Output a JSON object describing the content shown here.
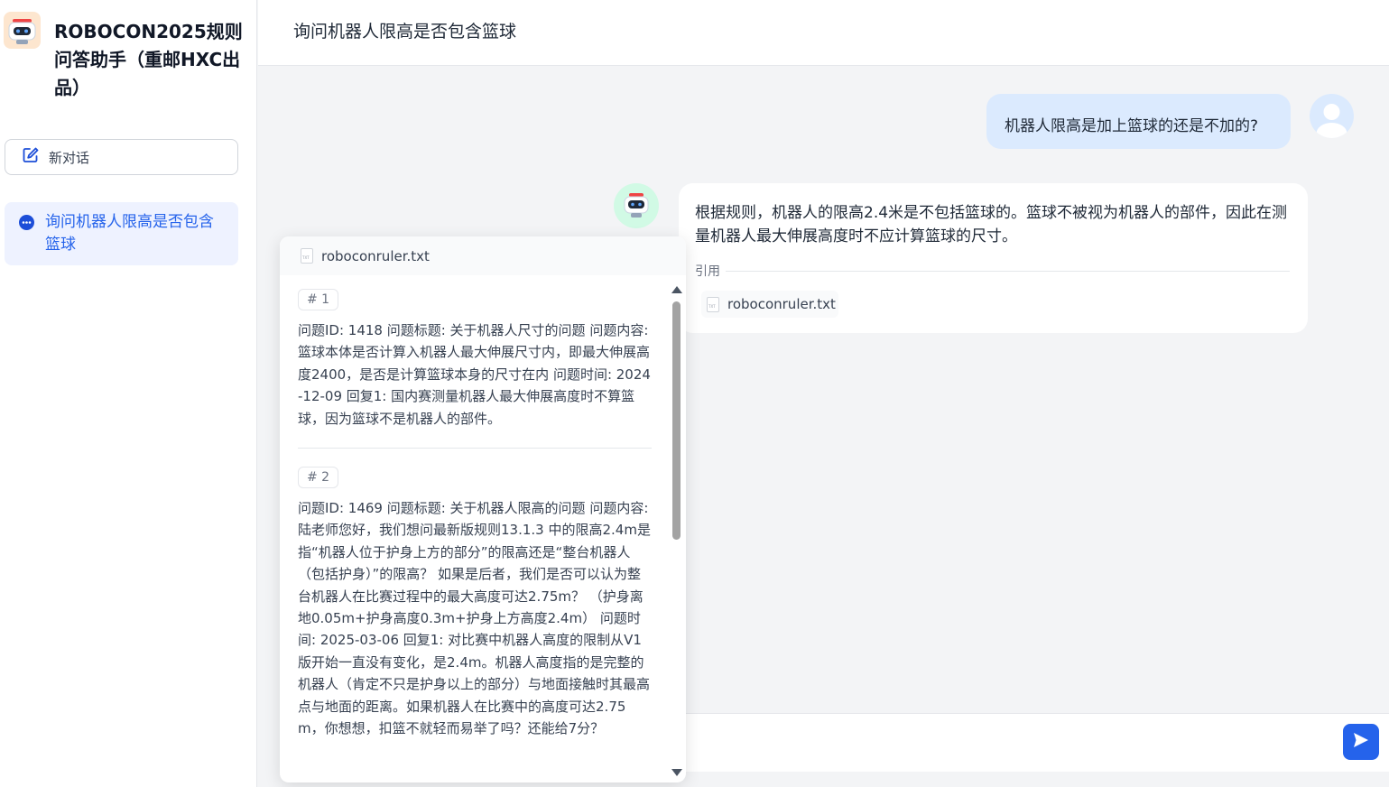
{
  "sidebar": {
    "app_title": "ROBOCON2025规则问答助手（重邮HXC出品）",
    "new_chat_label": "新对话",
    "conversations": [
      {
        "label": "询问机器人限高是否包含篮球"
      }
    ]
  },
  "header": {
    "title": "询问机器人限高是否包含篮球"
  },
  "messages": {
    "user_question": "机器人限高是加上篮球的还是不加的?",
    "bot_answer": "根据规则，机器人的限高2.4米是不包括篮球的。篮球不被视为机器人的部件，因此在测量机器人最大伸展高度时不应计算篮球的尺寸。",
    "citation_label": "引用",
    "citation_file": "roboconruler.txt"
  },
  "popover": {
    "file_name": "roboconruler.txt",
    "chunks": [
      {
        "badge": "# 1",
        "text": "问题ID: 1418 问题标题: 关于机器人尺寸的问题 问题内容: 篮球本体是否计算入机器人最大伸展尺寸内，即最大伸展高度2400，是否是计算篮球本身的尺寸在内 问题时间: 2024-12-09 回复1: 国内赛测量机器人最大伸展高度时不算篮球，因为篮球不是机器人的部件。"
      },
      {
        "badge": "# 2",
        "text": "问题ID: 1469 问题标题: 关于机器人限高的问题 问题内容: 陆老师您好，我们想问最新版规则13.1.3 中的限高2.4m是指“机器人位于护身上方的部分”的限高还是“整台机器人（包括护身）”的限高？ 如果是后者，我们是否可以认为整台机器人在比赛过程中的最大高度可达2.75m？ （护身离地0.05m+护身高度0.3m+护身上方高度2.4m） 问题时间: 2025-03-06 回复1: 对比赛中机器人高度的限制从V1版开始一直没有变化，是2.4m。机器人高度指的是完整的机器人（肯定不只是护身以上的部分）与地面接触时其最高点与地面的距离。如果机器人在比赛中的高度可达2.75m，你想想，扣篮不就轻而易举了吗？还能给7分？"
      }
    ]
  },
  "input": {
    "value": "",
    "placeholder": ""
  },
  "colors": {
    "accent": "#2563eb",
    "user_bubble": "#dbeafe",
    "selected_conv": "#eef2ff"
  },
  "icons": {
    "logo": "robot-icon",
    "new_chat": "edit-icon",
    "conversation": "chat-bubble-icon",
    "file": "txt-file-icon",
    "send": "send-icon"
  }
}
